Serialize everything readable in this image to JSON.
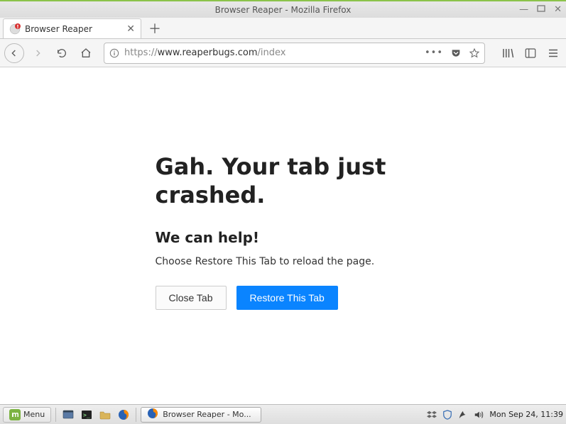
{
  "window": {
    "title": "Browser Reaper - Mozilla Firefox"
  },
  "tab": {
    "title": "Browser Reaper"
  },
  "url": {
    "scheme": "https://",
    "host": "www.reaperbugs.com",
    "path": "/index"
  },
  "crash": {
    "heading": "Gah. Your tab just crashed.",
    "subheading": "We can help!",
    "description": "Choose Restore This Tab to reload the page.",
    "close_label": "Close Tab",
    "restore_label": "Restore This Tab"
  },
  "taskbar": {
    "menu_label": "Menu",
    "active_task": "Browser Reaper - Mo...",
    "clock": "Mon Sep 24, 11:39"
  }
}
